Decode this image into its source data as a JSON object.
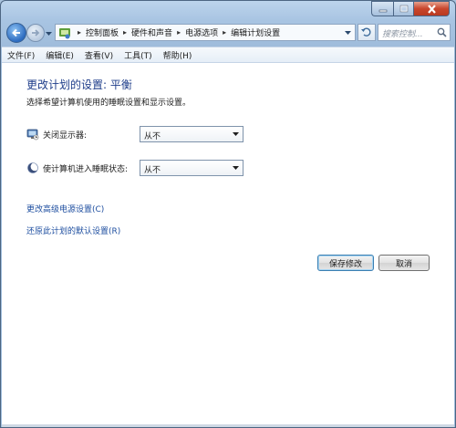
{
  "window": {
    "caption_icons": [
      "minimize-icon",
      "maximize-icon",
      "close-icon"
    ]
  },
  "nav": {
    "breadcrumbs": [
      "控制面板",
      "硬件和声音",
      "电源选项",
      "编辑计划设置"
    ],
    "search_placeholder": "搜索控制..."
  },
  "menu": {
    "items": [
      "文件(F)",
      "编辑(E)",
      "查看(V)",
      "工具(T)",
      "帮助(H)"
    ]
  },
  "main": {
    "title": "更改计划的设置: 平衡",
    "subtitle": "选择希望计算机使用的睡眠设置和显示设置。",
    "settings": [
      {
        "label": "关闭显示器:",
        "value": "从不",
        "icon": "monitor-icon"
      },
      {
        "label": "使计算机进入睡眠状态:",
        "value": "从不",
        "icon": "moon-icon"
      }
    ],
    "links": [
      "更改高级电源设置(C)",
      "还原此计划的默认设置(R)"
    ],
    "buttons": {
      "save": "保存修改",
      "cancel": "取消"
    }
  },
  "colors": {
    "title_blue": "#1e3d8a",
    "link_blue": "#1f4fa0",
    "chrome": "#a8c4e2"
  }
}
